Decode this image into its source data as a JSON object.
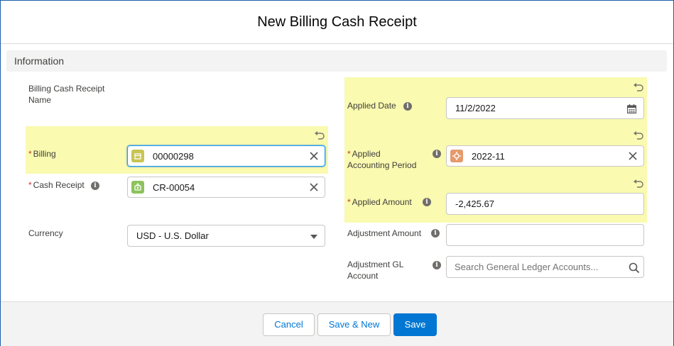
{
  "modal": {
    "title": "New Billing Cash Receipt"
  },
  "section": {
    "title": "Information"
  },
  "left": {
    "name_label_1": "Billing Cash Receipt",
    "name_label_2": "Name",
    "billing_label": "Billing",
    "billing_value": "00000298",
    "cash_receipt_label": "Cash Receipt",
    "cash_receipt_value": "CR-00054",
    "currency_label": "Currency",
    "currency_value": "USD - U.S. Dollar"
  },
  "right": {
    "applied_date_label": "Applied Date",
    "applied_date_value": "11/2/2022",
    "period_label_1": "Applied",
    "period_label_2": "Accounting Period",
    "period_value": "2022-11",
    "amount_label": "Applied Amount",
    "amount_value": "-2,425.67",
    "adj_amount_label": "Adjustment Amount",
    "adj_amount_value": "",
    "adj_gl_label_1": "Adjustment GL",
    "adj_gl_label_2": "Account",
    "adj_gl_placeholder": "Search General Ledger Accounts..."
  },
  "required_marker": "*",
  "footer": {
    "cancel": "Cancel",
    "save_new": "Save & New",
    "save": "Save"
  },
  "colors": {
    "brand": "#0176d3",
    "highlight": "#fafab0",
    "billing_icon": "#c8c553",
    "cash_icon": "#8dc35c",
    "period_icon": "#e59a6c"
  },
  "icons": [
    "undo-icon",
    "info-icon",
    "clear-icon",
    "calendar-icon",
    "search-icon",
    "chevron-down-icon"
  ]
}
